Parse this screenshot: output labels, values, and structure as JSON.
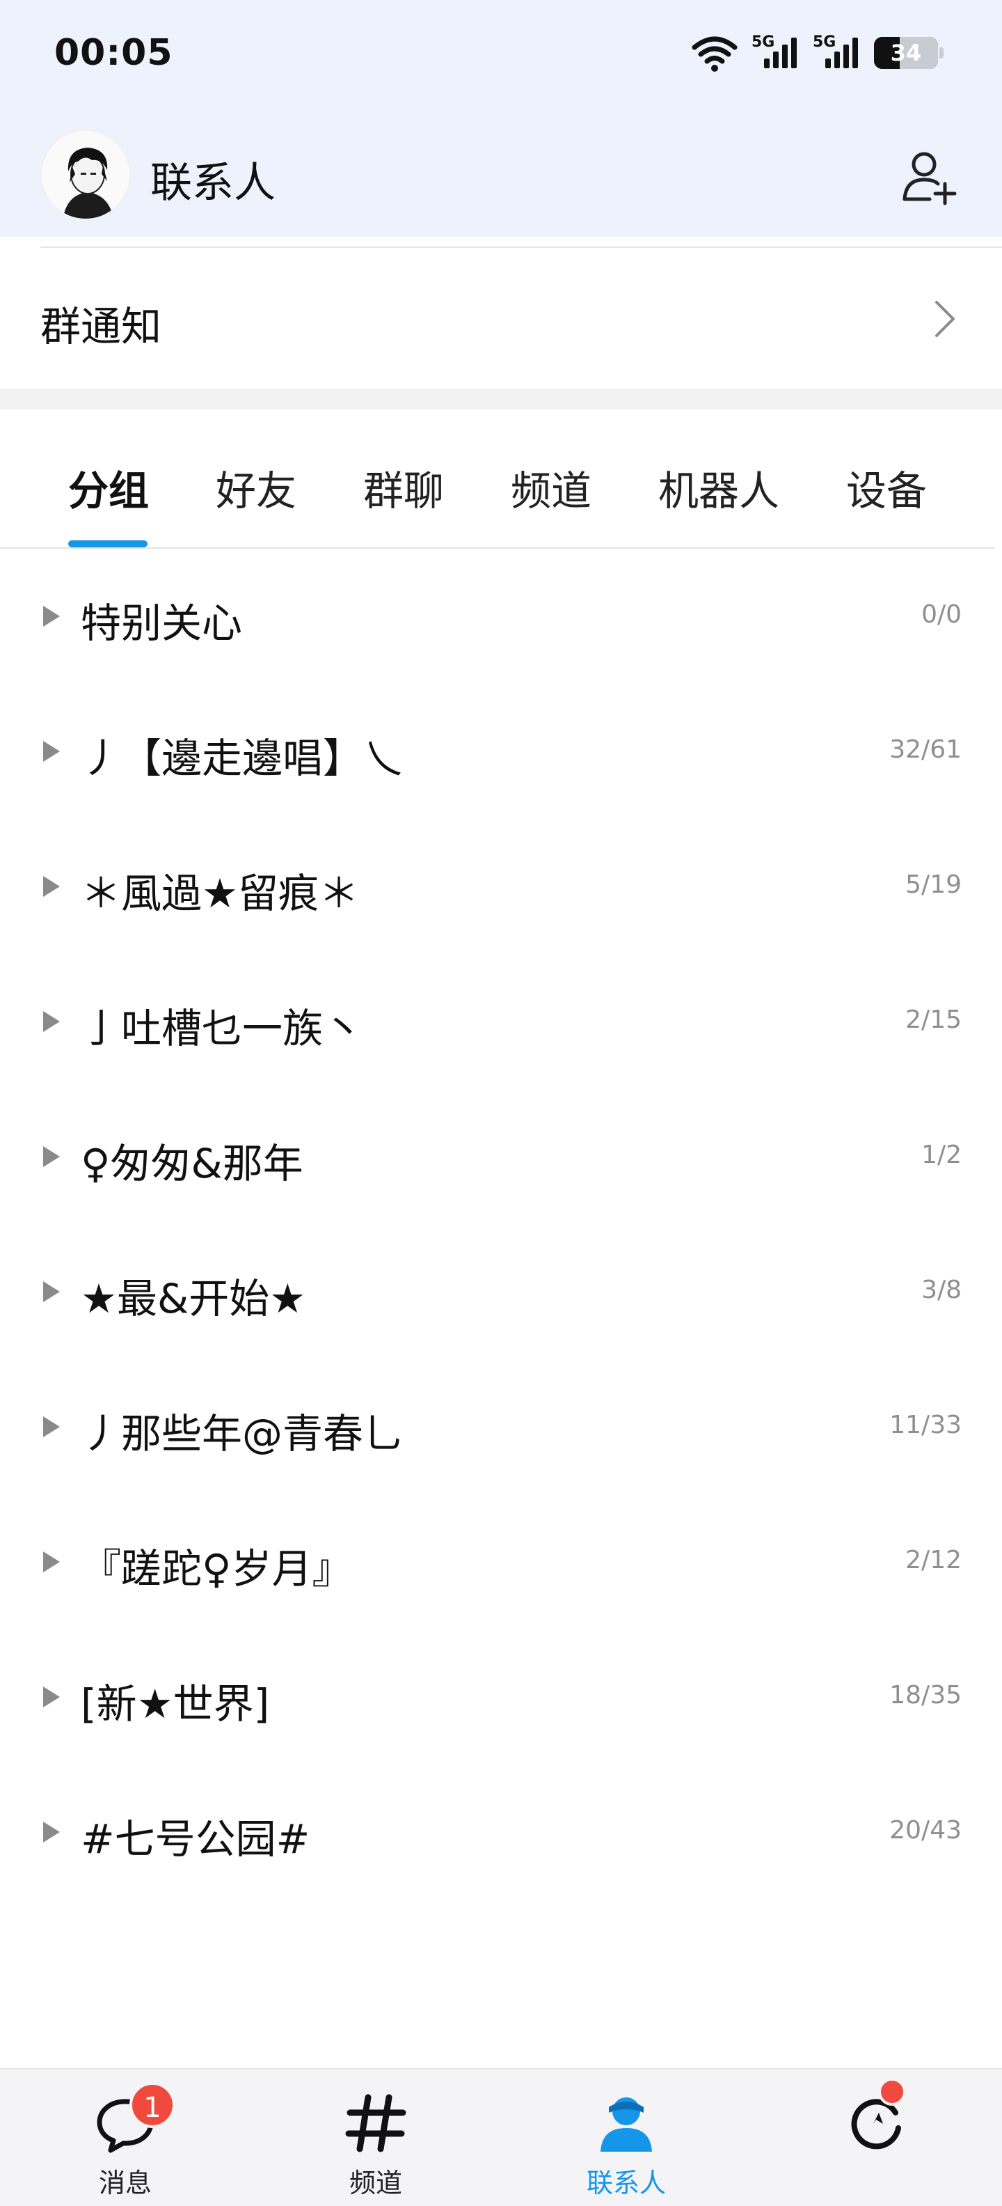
{
  "status_bar": {
    "time": "00:05",
    "network_1": "5G",
    "network_2": "5G",
    "battery": "34"
  },
  "header": {
    "title": "联系人",
    "avatar_icon": "user-avatar",
    "add_contact_icon": "add-contact-icon"
  },
  "group_notice": {
    "label": "群通知"
  },
  "tabs": [
    {
      "label": "分组",
      "active": true
    },
    {
      "label": "好友",
      "active": false
    },
    {
      "label": "群聊",
      "active": false
    },
    {
      "label": "频道",
      "active": false
    },
    {
      "label": "机器人",
      "active": false
    },
    {
      "label": "设备",
      "active": false
    }
  ],
  "groups": [
    {
      "name": "特别关心",
      "count": "0/0"
    },
    {
      "name": "丿【邊走邊唱】乀",
      "count": "32/61"
    },
    {
      "name": "＊風過★留痕＊",
      "count": "5/19"
    },
    {
      "name": "亅吐槽乜一族丶",
      "count": "2/15"
    },
    {
      "name": "♀匆匆&那年",
      "count": "1/2"
    },
    {
      "name": "★最&开始★",
      "count": "3/8"
    },
    {
      "name": "丿那些年@青春乚",
      "count": "11/33"
    },
    {
      "name": "『蹉跎♀岁月』",
      "count": "2/12"
    },
    {
      "name": "[新★世界]",
      "count": "18/35"
    },
    {
      "name": "#七号公园#",
      "count": "20/43"
    }
  ],
  "bottom_nav": {
    "messages": {
      "label": "消息",
      "badge": "1"
    },
    "channels": {
      "label": "频道"
    },
    "contacts": {
      "label": "联系人"
    },
    "activity": {
      "label": ""
    }
  },
  "colors": {
    "accent": "#1596e8",
    "badge": "#f04a3e",
    "header_bg": "#eef2fc"
  }
}
